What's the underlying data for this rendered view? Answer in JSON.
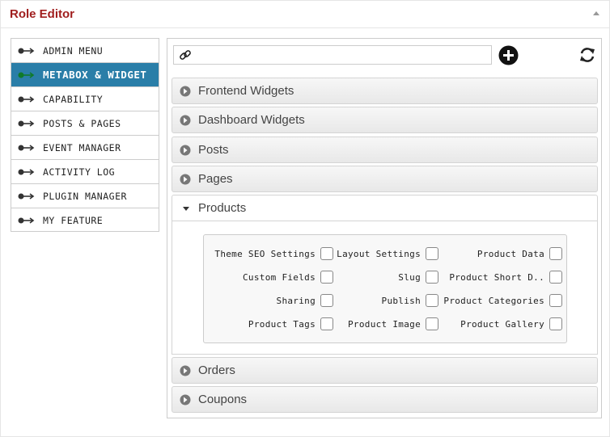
{
  "panel": {
    "title": "Role Editor"
  },
  "sidebar": {
    "items": [
      {
        "label": "ADMIN MENU"
      },
      {
        "label": "METABOX & WIDGET"
      },
      {
        "label": "CAPABILITY"
      },
      {
        "label": "POSTS & PAGES"
      },
      {
        "label": "EVENT MANAGER"
      },
      {
        "label": "ACTIVITY LOG"
      },
      {
        "label": "PLUGIN MANAGER"
      },
      {
        "label": "MY FEATURE"
      }
    ],
    "active_index": 1
  },
  "toolbar": {
    "link_input_value": "",
    "link_icon": "link-icon",
    "add_icon": "plus-circle-icon",
    "refresh_icon": "refresh-icon"
  },
  "sections": [
    {
      "label": "Frontend Widgets",
      "expanded": false
    },
    {
      "label": "Dashboard Widgets",
      "expanded": false
    },
    {
      "label": "Posts",
      "expanded": false
    },
    {
      "label": "Pages",
      "expanded": false
    },
    {
      "label": "Products",
      "expanded": true
    },
    {
      "label": "Orders",
      "expanded": false
    },
    {
      "label": "Coupons",
      "expanded": false
    }
  ],
  "products_options": [
    {
      "label": "Theme SEO Settings",
      "checked": false
    },
    {
      "label": "Layout Settings",
      "checked": false
    },
    {
      "label": "Product Data",
      "checked": false
    },
    {
      "label": "Custom Fields",
      "checked": false
    },
    {
      "label": "Slug",
      "checked": false
    },
    {
      "label": "Product Short D..",
      "checked": false
    },
    {
      "label": "Sharing",
      "checked": false
    },
    {
      "label": "Publish",
      "checked": false
    },
    {
      "label": "Product Categories",
      "checked": false
    },
    {
      "label": "Product Tags",
      "checked": false
    },
    {
      "label": "Product Image",
      "checked": false
    },
    {
      "label": "Product Gallery",
      "checked": false
    }
  ],
  "colors": {
    "title": "#a01e1e",
    "active_item_bg": "#2a7ea8",
    "active_arrow": "#0f7a2a",
    "icon_dark": "#333333"
  }
}
